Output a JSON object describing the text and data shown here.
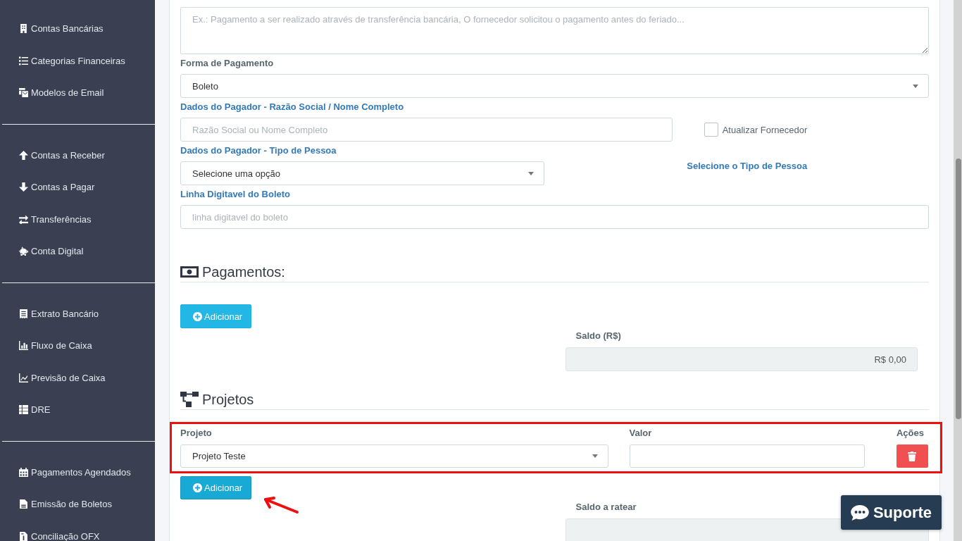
{
  "sidebar": {
    "groups": [
      {
        "items": [
          {
            "label": "Contas Bancárias"
          },
          {
            "label": "Categorias Financeiras"
          },
          {
            "label": "Modelos de Email"
          }
        ]
      },
      {
        "items": [
          {
            "label": "Contas a Receber"
          },
          {
            "label": "Contas a Pagar"
          },
          {
            "label": "Transferências"
          },
          {
            "label": "Conta Digital"
          }
        ]
      },
      {
        "items": [
          {
            "label": "Extrato Bancário"
          },
          {
            "label": "Fluxo de Caixa"
          },
          {
            "label": "Previsão de Caixa"
          },
          {
            "label": "DRE"
          }
        ]
      },
      {
        "items": [
          {
            "label": "Pagamentos Agendados"
          },
          {
            "label": "Emissão de Boletos"
          },
          {
            "label": "Conciliação OFX"
          }
        ]
      }
    ]
  },
  "form": {
    "notes": {
      "placeholder": "Ex.: Pagamento a ser realizado através de transferência bancária, O fornecedor solicitou o pagamento antes do feriado..."
    },
    "payment_method": {
      "label": "Forma de Pagamento",
      "value": "Boleto"
    },
    "payer_name": {
      "label": "Dados do Pagador - Razão Social / Nome Completo",
      "placeholder": "Razão Social ou Nome Completo"
    },
    "update_supplier": {
      "label": "Atualizar Fornecedor",
      "checked": false
    },
    "payer_type": {
      "label": "Dados do Pagador - Tipo de Pessoa",
      "value": "Selecione uma opção",
      "hint": "Selecione o Tipo de Pessoa"
    },
    "barcode_line": {
      "label": "Linha Digitavel do Boleto",
      "placeholder": "linha digitavel do boleto"
    }
  },
  "payments": {
    "title": "Pagamentos:",
    "add_button": {
      "label": "Adicionar",
      "focused": false
    },
    "balance": {
      "label": "Saldo (R$)",
      "value": "R$ 0,00"
    }
  },
  "projects": {
    "title": "Projetos",
    "columns": [
      "Projeto",
      "Valor",
      "Ações"
    ],
    "rows": [
      {
        "project": "Projeto Teste"
      }
    ],
    "add_button": {
      "label": "Adicionar",
      "focused": true
    },
    "balance": {
      "label": "Saldo a ratear"
    }
  },
  "support_button": {
    "label": "Suporte"
  }
}
